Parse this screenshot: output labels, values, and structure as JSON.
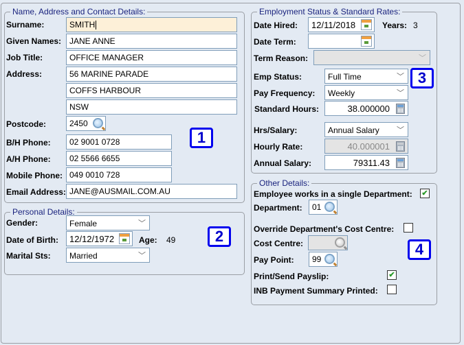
{
  "name_group": {
    "legend": "Name, Address and Contact Details:",
    "surname_label": "Surname:",
    "surname": "SMITH",
    "given_label": "Given Names:",
    "given": "JANE ANNE",
    "job_label": "Job Title:",
    "job": "OFFICE MANAGER",
    "address_label": "Address:",
    "address1": "56 MARINE PARADE",
    "address2": "COFFS HARBOUR",
    "address3": "NSW",
    "postcode_label": "Postcode:",
    "postcode": "2450",
    "bh_label": "B/H Phone:",
    "bh": "02 9001 0728",
    "ah_label": "A/H Phone:",
    "ah": "02 5566 6655",
    "mobile_label": "Mobile Phone:",
    "mobile": "049 0010 728",
    "email_label": "Email Address:",
    "email": "JANE@AUSMAIL.COM.AU",
    "badge": "1"
  },
  "personal_group": {
    "legend": "Personal Details:",
    "gender_label": "Gender:",
    "gender": "Female",
    "dob_label": "Date of Birth:",
    "dob": "12/12/1972",
    "age_label": "Age:",
    "age": "49",
    "marital_label": "Marital Sts:",
    "marital": "Married",
    "badge": "2"
  },
  "employment_group": {
    "legend": "Employment Status & Standard Rates:",
    "hired_label": "Date Hired:",
    "hired": "12/11/2018",
    "years_label": "Years:",
    "years": "3",
    "term_label": "Date Term:",
    "term": "",
    "reason_label": "Term Reason:",
    "reason": "",
    "status_label": "Emp Status:",
    "status": "Full Time",
    "freq_label": "Pay Frequency:",
    "freq": "Weekly",
    "hours_label": "Standard Hours:",
    "hours": "38.000000",
    "hrs_salary_label": "Hrs/Salary:",
    "hrs_salary": "Annual Salary",
    "rate_label": "Hourly Rate:",
    "rate": "40.000001",
    "salary_label": "Annual Salary:",
    "salary": "79311.43",
    "badge": "3"
  },
  "other_group": {
    "legend": "Other Details:",
    "single_dept_label": "Employee works in a single Department:",
    "single_dept": true,
    "dept_label": "Department:",
    "dept": "01",
    "override_label": "Override Department's Cost Centre:",
    "override": false,
    "cost_label": "Cost Centre:",
    "cost": "",
    "paypoint_label": "Pay Point:",
    "paypoint": "99",
    "payslip_label": "Print/Send Payslip:",
    "payslip": true,
    "inb_label": "INB Payment Summary Printed:",
    "inb": false,
    "badge": "4",
    "check_glyph": "✔"
  }
}
